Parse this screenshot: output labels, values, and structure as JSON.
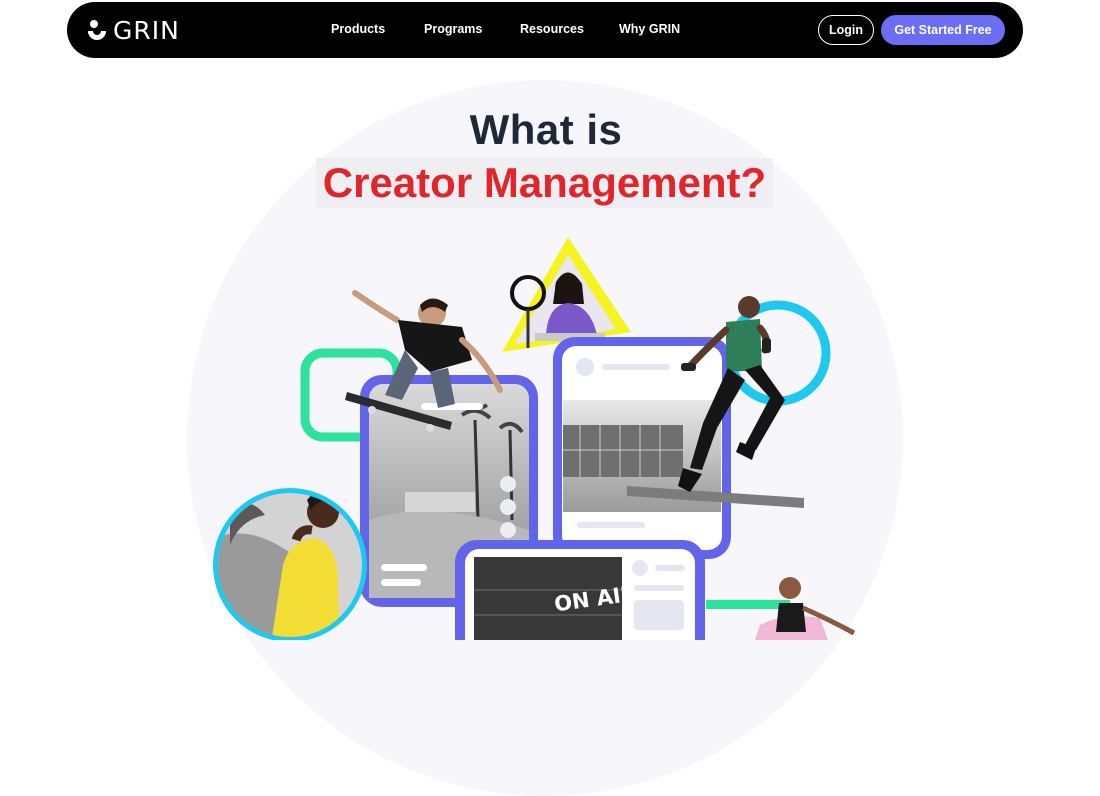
{
  "nav": {
    "logo_text": "GRIN",
    "links": [
      {
        "label": "Products"
      },
      {
        "label": "Programs"
      },
      {
        "label": "Resources"
      },
      {
        "label": "Why GRIN"
      }
    ],
    "login_label": "Login",
    "cta_label": "Get Started Free"
  },
  "hero": {
    "title_line1": "What is",
    "title_line2": "Creator Management?",
    "onair_text": "ON AIR"
  },
  "colors": {
    "nav_bg": "#000000",
    "accent": "#6b6ef4",
    "title_dark": "#1f2836",
    "title_red": "#e0252b",
    "shape_green": "#2de39b",
    "shape_cyan": "#1ec8ef",
    "shape_yellow": "#f6f323",
    "frame_purple": "#6264ea"
  }
}
